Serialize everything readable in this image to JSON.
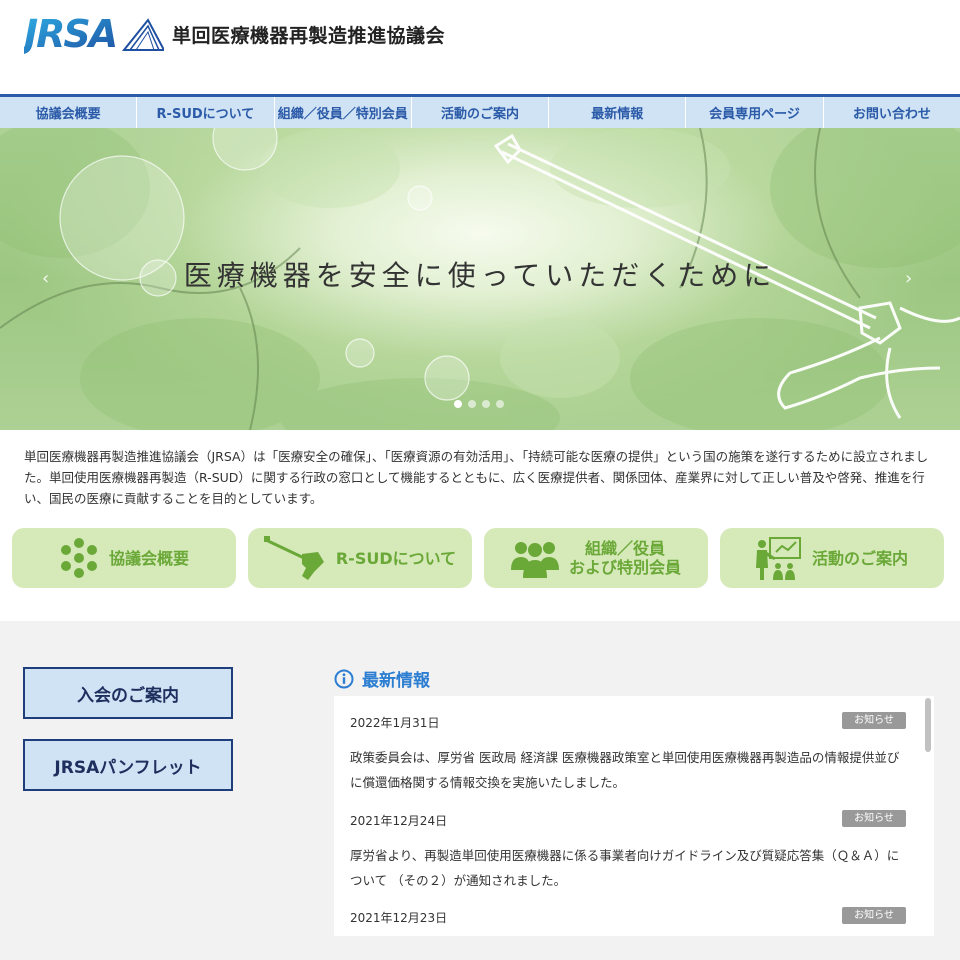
{
  "header": {
    "logo_text": "JRSA",
    "org_name": "単回医療機器再製造推進協議会",
    "brand_color": "#2b5aa8"
  },
  "nav": {
    "items": [
      {
        "label": "協議会概要"
      },
      {
        "label": "R-SUDについて"
      },
      {
        "label": "組織／役員／特別会員"
      },
      {
        "label": "活動のご案内"
      },
      {
        "label": "最新情報"
      },
      {
        "label": "会員専用ページ"
      },
      {
        "label": "お問い合わせ"
      }
    ]
  },
  "hero": {
    "title": "医療機器を安全に使っていただくために",
    "prev_arrow": "‹",
    "next_arrow": "›",
    "slides": 4,
    "active_slide": 1
  },
  "intro": {
    "text": "単回医療機器再製造推進協議会（JRSA）は「医療安全の確保」、「医療資源の有効活用」、「持続可能な医療の提供」という国の施策を遂行するために設立されました。単回使用医療機器再製造（R-SUD）に関する行政の窓口として機能するとともに、広く医療提供者、関係団体、産業界に対して正しい普及や啓発、推進を行い、国民の医療に貢献することを目的としています。"
  },
  "cards": [
    {
      "label": "協議会概要",
      "icon": "circle-cluster-icon"
    },
    {
      "label": "R-SUDについて",
      "icon": "medical-device-icon"
    },
    {
      "label": "組織／役員\nおよび特別会員",
      "line1": "組織／役員",
      "line2": "および特別会員",
      "icon": "people-group-icon"
    },
    {
      "label": "活動のご案内",
      "icon": "presentation-icon"
    }
  ],
  "side_buttons": {
    "membership": "入会のご案内",
    "pamphlet": "JRSAパンフレット"
  },
  "news": {
    "heading": "最新情報",
    "items": [
      {
        "date": "2022年1月31日",
        "badge": "お知らせ",
        "text": "政策委員会は、厚労省 医政局 経済課 医療機器政策室と単回使用医療機器再製造品の情報提供並びに償還価格関する情報交換を実施いたしました。"
      },
      {
        "date": "2021年12月24日",
        "badge": "お知らせ",
        "text": "厚労省より、再製造単回使用医療機器に係る事業者向けガイドライン及び質疑応答集（Ｑ＆Ａ）について （その２）が通知されました。"
      },
      {
        "date": "2021年12月23日",
        "badge": "お知らせ",
        "text": ""
      }
    ]
  },
  "colors": {
    "nav_bg": "#cfe3f5",
    "card_bg": "#d6e9b8",
    "card_icon": "#6aa838",
    "news_heading": "#2b7ed1",
    "badge_bg": "#999999"
  }
}
